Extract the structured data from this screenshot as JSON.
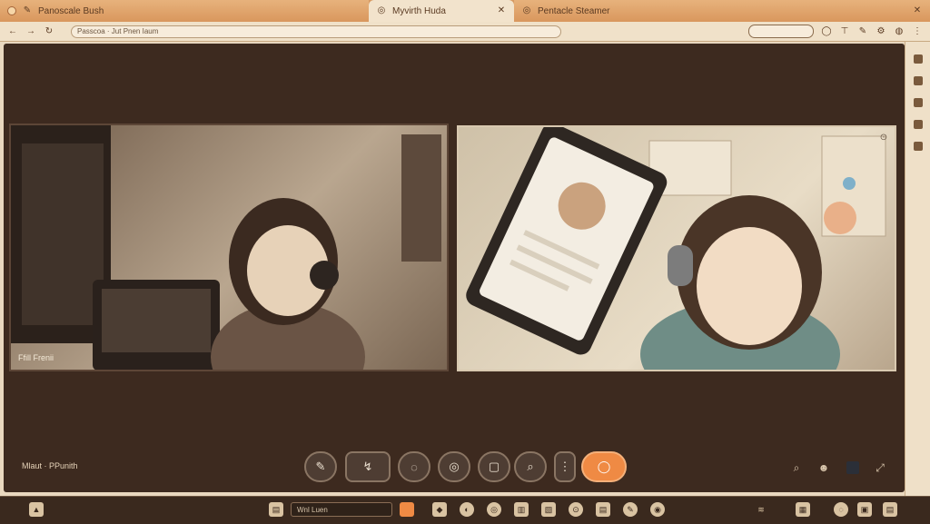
{
  "tabs": [
    {
      "label": "Panoscale Bush",
      "active": false
    },
    {
      "label": "Myvirth Huda",
      "active": true
    },
    {
      "label": "Pentacle Steamer",
      "active": false
    }
  ],
  "address": {
    "url": "Passcoa · Jut Pnen Iaum"
  },
  "videos": [
    {
      "label": "Ffill Frenii"
    },
    {
      "label": ""
    }
  ],
  "caption": "Mlaut · PPunith",
  "controls": [
    {
      "icon": "mic-icon",
      "glyph": "✎"
    },
    {
      "icon": "pointer-icon",
      "glyph": "↯"
    },
    {
      "icon": "chat-icon",
      "glyph": "◌"
    },
    {
      "icon": "record-icon",
      "glyph": "◎"
    },
    {
      "icon": "screen-share-icon",
      "glyph": "▢"
    },
    {
      "icon": "search-icon",
      "glyph": "⌕"
    },
    {
      "icon": "more-icon",
      "glyph": "⋮"
    },
    {
      "icon": "end-call-icon",
      "glyph": "◯"
    }
  ],
  "right_tools": [
    {
      "icon": "search-icon",
      "glyph": "⌕"
    },
    {
      "icon": "people-icon",
      "glyph": "☻"
    },
    {
      "icon": "layout-icon",
      "glyph": "■"
    },
    {
      "icon": "expand-icon",
      "glyph": "⤢"
    }
  ],
  "taskbar": {
    "field_text": "Wnl Luen"
  },
  "colors": {
    "accent": "#ef8a44",
    "stage": "#3d2a1f",
    "tabbar": "#d79a63"
  }
}
